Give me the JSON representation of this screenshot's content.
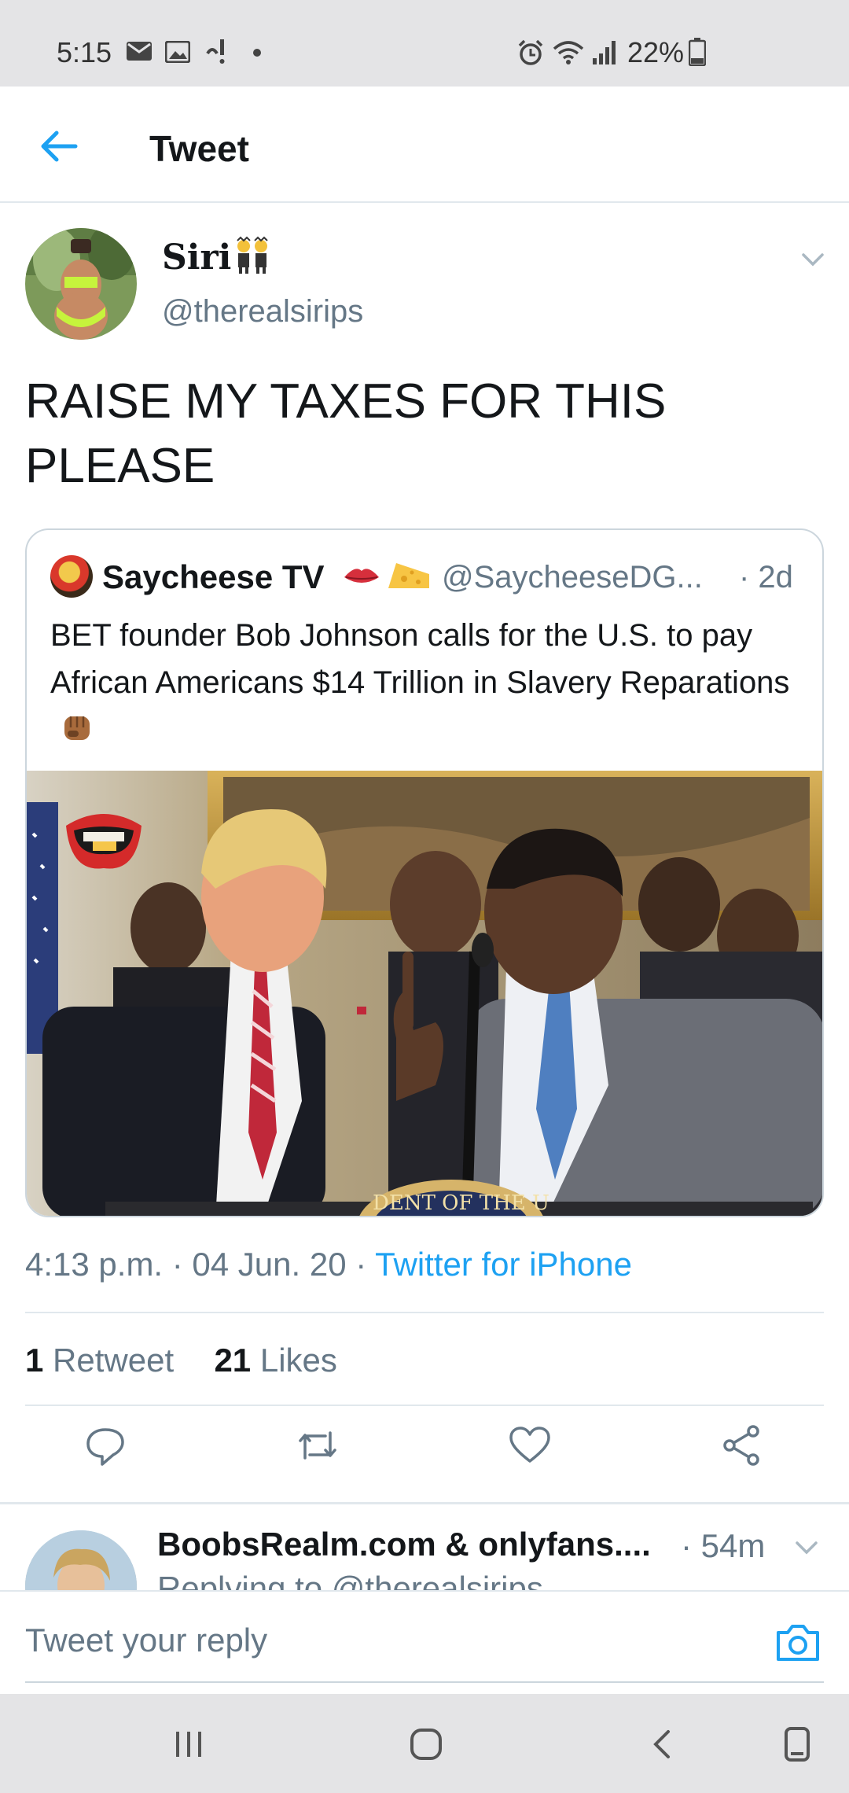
{
  "status_bar": {
    "time": "5:15",
    "battery": "22%",
    "icons": [
      "mail-icon",
      "gallery-icon",
      "vibrate-alert-icon",
      "dot-icon",
      "alarm-icon",
      "wifi-icon",
      "signal-icon",
      "battery-icon"
    ]
  },
  "app_bar": {
    "title": "Tweet",
    "back_icon": "back-arrow-icon"
  },
  "tweet": {
    "display_name": "Siri",
    "name_emoji": "two-people-emoji",
    "handle": "@therealsirips",
    "text": "RAISE MY TAXES FOR THIS PLEASE",
    "quoted": {
      "name": "Saycheese TV",
      "emojis": [
        "lips-emoji",
        "cheese-emoji"
      ],
      "handle": "@SaycheeseDG...",
      "time": "· 2d",
      "text": "BET founder Bob Johnson calls for the U.S. to pay African Americans $14 Trillion in Slavery Reparations",
      "text_emoji": "raised-fist-emoji",
      "seal_text": "DENT OF THE U"
    },
    "timestamp": "4:13 p.m. · 04 Jun. 20 · ",
    "source": "Twitter for iPhone",
    "retweets_count": "1",
    "retweets_label": "Retweet",
    "likes_count": "21",
    "likes_label": "Likes",
    "actions": [
      "reply-icon",
      "retweet-icon",
      "like-icon",
      "share-icon"
    ]
  },
  "reply_preview": {
    "name": "BoobsRealm.com & onlyfans....",
    "time": "· 54m",
    "subtext": "Replying to @therealsirips"
  },
  "reply_bar": {
    "placeholder": "Tweet your reply"
  },
  "colors": {
    "accent": "#1da1f2",
    "secondary_text": "#657786",
    "divider": "#e1e8ed"
  }
}
